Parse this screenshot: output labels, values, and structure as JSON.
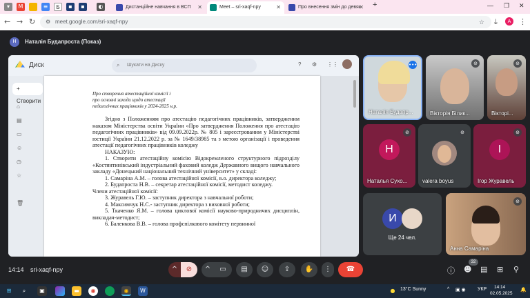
{
  "browser": {
    "tabs": [
      {
        "label": "Дистанційне навчання в ВСП",
        "active": false
      },
      {
        "label": "Meet – sri-xaqf-npy",
        "active": true
      },
      {
        "label": "Про внесення змін до девяк",
        "active": false
      }
    ],
    "new_tab": "+",
    "url": "meet.google.com/sri-xaqf-npy",
    "profile_initial": "A"
  },
  "meet": {
    "presenter_initial": "Н",
    "presenter_label": "Наталія Будапроста (Показ)",
    "meeting_time": "14:14",
    "meeting_code": "sri-xaqf-npy",
    "participants_badge": "32"
  },
  "drive": {
    "title": "Диск",
    "search_placeholder": "Шукати на Диску",
    "new_label": "+ Створити"
  },
  "document": {
    "header_lines": [
      "Про створення атестаційної комісії і",
      "про основні заходи щодо атестації",
      "педагогічних працівників у 2024-2025 н.р."
    ],
    "paragraph1": "Згідно з Положенням про атестацію педагогічних працівників, затвердженим наказом Міністерства освіти України «Про затвердження Положення про атестацію педагогічних працівників» від 09.09.2022р. № 805 і зареєстрованим у Міністерстві юстиції України 21.12.2022 р. за № 1649/38985 та з метою організації і проведення атестації педагогічних працівників коледжу",
    "order_word": "НАКАЗУЮ:",
    "item1": "1. Створити атестаційну комісію Відокремленого структурного підрозділу «Костянтинівський індустріальний фаховий коледж Державного вищого навчального закладу «Донецький національний технічний університет» у складі:",
    "members": [
      "1. Самаріна А.М. – голова атестаційної комісії, в.о. директора коледжу;",
      "2. Будапроста Н.В. – секретар атестаційної комісії, методист коледжу."
    ],
    "members_title": "Члени атестаційної комісії:",
    "members2": [
      "3. Журавель Г.Ю. – заступник директора з навчальної роботи;",
      "4. Максимчук Н.С.- заступник директора з виховної роботи;",
      "5. Ткаченко Я.М. – голова циклової комісії науково-природничих дисциплін, викладач-методист;",
      "6. Баленкова В.В. – голова профспілкового комітету первинної"
    ]
  },
  "participants": [
    {
      "name": "Наталія Будапр...",
      "speaking": true
    },
    {
      "name": "Вікторія Білик...",
      "muted": true
    },
    {
      "name": "Вікторі...",
      "muted": true
    },
    {
      "name": "Наталья Сухо...",
      "initial": "Н",
      "color": "#c2185b",
      "muted": true
    },
    {
      "name": "valera boyus",
      "muted": true
    },
    {
      "name": "Ігор Журавель",
      "initial": "І",
      "color": "#ad1457",
      "muted": true
    },
    {
      "name": "Ще 24 чел.",
      "initial": "И",
      "color": "#3949ab"
    },
    {
      "name": "Анна Самаріна",
      "muted": true
    }
  ],
  "taskbar": {
    "weather": "13°C  Sunny",
    "lang": "УКР",
    "time": "14:14",
    "date": "02.05.2025"
  },
  "colors": {
    "meet_bg": "#202124",
    "end_call": "#ea4335",
    "tab_strip": "#fbe5f0"
  }
}
